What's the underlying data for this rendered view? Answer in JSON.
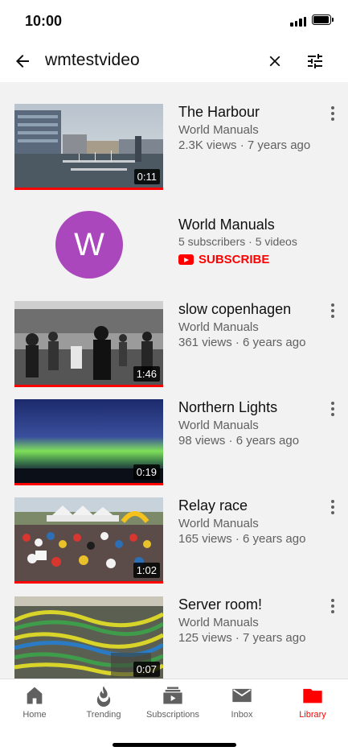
{
  "status_bar": {
    "time": "10:00"
  },
  "search": {
    "query": "wmtestvideo"
  },
  "results": [
    {
      "title": "The Harbour",
      "channel": "World Manuals",
      "meta": "2.3K views · 7 years ago",
      "duration": "0:11"
    }
  ],
  "channel": {
    "initial": "W",
    "name": "World Manuals",
    "meta": "5 subscribers · 5 videos",
    "subscribe_label": "SUBSCRIBE"
  },
  "videos": [
    {
      "title": "slow copenhagen",
      "channel": "World Manuals",
      "meta": "361 views · 6 years ago",
      "duration": "1:46"
    },
    {
      "title": "Northern Lights",
      "channel": "World Manuals",
      "meta": "98 views · 6 years ago",
      "duration": "0:19"
    },
    {
      "title": "Relay race",
      "channel": "World Manuals",
      "meta": "165 views · 6 years ago",
      "duration": "1:02"
    },
    {
      "title": "Server room!",
      "channel": "World Manuals",
      "meta": "125 views · 7 years ago",
      "duration": "0:07"
    }
  ],
  "nav": {
    "items": [
      {
        "label": "Home",
        "icon": "home-icon"
      },
      {
        "label": "Trending",
        "icon": "flame-icon"
      },
      {
        "label": "Subscriptions",
        "icon": "subscriptions-icon"
      },
      {
        "label": "Inbox",
        "icon": "mail-icon"
      },
      {
        "label": "Library",
        "icon": "folder-icon"
      }
    ],
    "active": "Library"
  },
  "colors": {
    "accent": "#ff0000",
    "avatar": "#ab47bc",
    "secondary_text": "#606060",
    "results_background": "#f2f2f2"
  }
}
